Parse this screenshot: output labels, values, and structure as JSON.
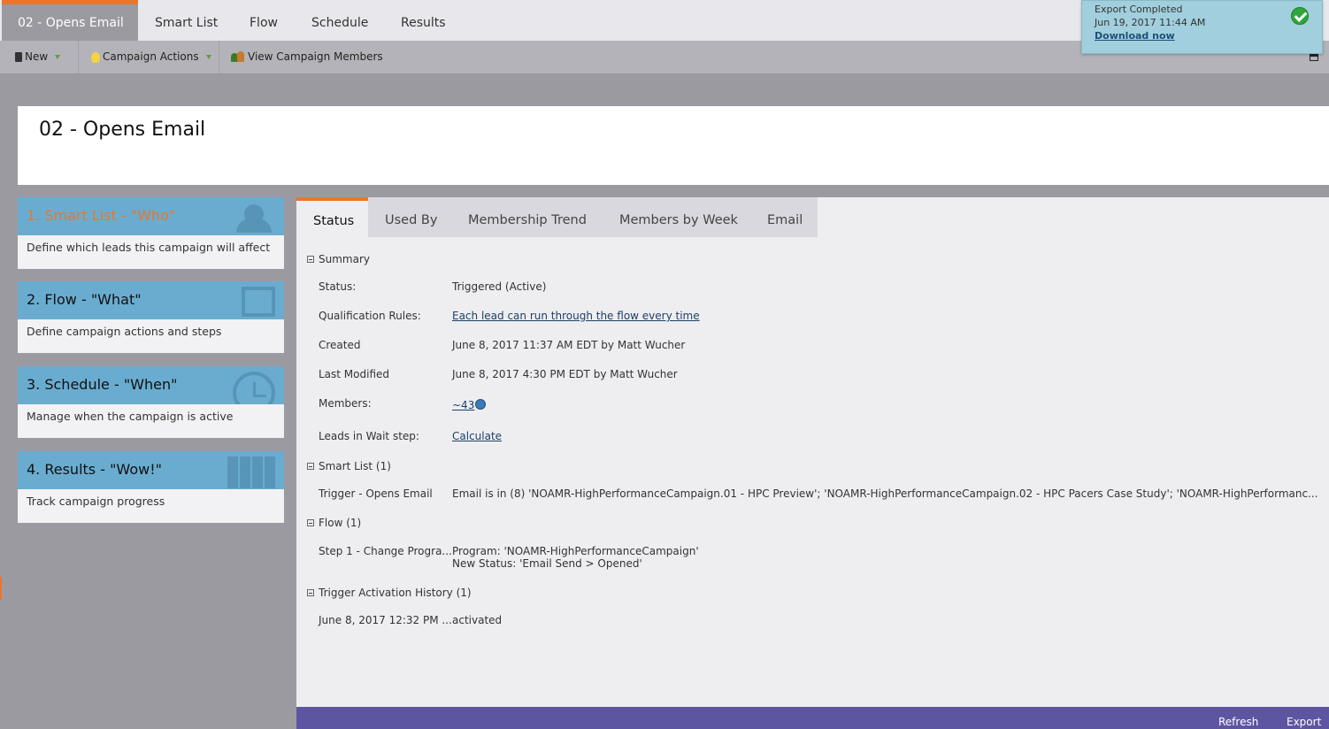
{
  "top_tabs": {
    "active": "02 - Opens Email",
    "smart_list": "Smart List",
    "flow": "Flow",
    "schedule": "Schedule",
    "results": "Results"
  },
  "toolbar": {
    "new": "New",
    "campaign_actions": "Campaign Actions",
    "view_members": "View Campaign Members"
  },
  "notification": {
    "title": "Export Completed",
    "timestamp": "Jun 19, 2017 11:44 AM",
    "link": "Download now"
  },
  "page_title": "02 - Opens Email",
  "cards": [
    {
      "title": "1. Smart List - \"Who\"",
      "desc": "Define which leads this campaign will affect"
    },
    {
      "title": "2. Flow - \"What\"",
      "desc": "Define campaign actions and steps"
    },
    {
      "title": "3. Schedule - \"When\"",
      "desc": "Manage when the campaign is active"
    },
    {
      "title": "4. Results - \"Wow!\"",
      "desc": "Track campaign progress"
    }
  ],
  "inner_tabs": {
    "status": "Status",
    "used_by": "Used By",
    "membership_trend": "Membership Trend",
    "members_by_week": "Members by Week",
    "email": "Email"
  },
  "summary": {
    "header": "Summary",
    "status_label": "Status:",
    "status_value": "Triggered (Active)",
    "qual_label": "Qualification Rules:",
    "qual_value": "Each lead can run through the flow every time",
    "created_label": "Created",
    "created_value": "June 8, 2017 11:37 AM EDT by Matt Wucher",
    "modified_label": "Last Modified",
    "modified_value": "June 8, 2017 4:30 PM EDT by Matt Wucher",
    "members_label": "Members:",
    "members_value": "~43",
    "wait_label": "Leads in Wait step:",
    "wait_value": "Calculate"
  },
  "smart_list": {
    "header": "Smart List (1)",
    "trigger_label": "Trigger - Opens Email",
    "trigger_value": "Email is in (8) 'NOAMR-HighPerformanceCampaign.01 - HPC Preview'; 'NOAMR-HighPerformanceCampaign.02 - HPC Pacers Case Study'; 'NOAMR-HighPerformanc..."
  },
  "flow": {
    "header": "Flow (1)",
    "step_label": "Step 1 - Change Progra...",
    "step_line1": "Program: 'NOAMR-HighPerformanceCampaign'",
    "step_line2": "New Status: 'Email Send > Opened'"
  },
  "history": {
    "header": "Trigger Activation History (1)",
    "date": "June 8, 2017 12:32 PM ...",
    "action": "activated"
  },
  "footer": {
    "refresh": "Refresh",
    "export": "Export"
  },
  "colors": {
    "accent_orange": "#e8762d",
    "card_blue": "#6aacd0",
    "footer_purple": "#5e55a2",
    "notify_blue": "#a1cfdd"
  }
}
